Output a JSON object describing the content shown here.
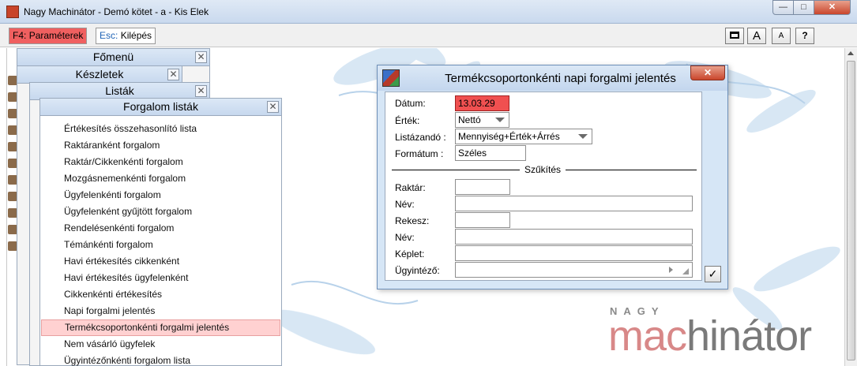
{
  "window": {
    "title": "Nagy Machinátor - Demó kötet - a - Kis Elek",
    "min": "—",
    "max": "□",
    "close": "✕"
  },
  "toolbar": {
    "f4_key": "F4:",
    "f4_label": "Paraméterek",
    "esc_key": "Esc:",
    "esc_label": "Kilépés",
    "font_big": "A",
    "font_small": "A",
    "help": "?"
  },
  "panels": {
    "fomenu": "Főmenü",
    "keszletek": "Készletek",
    "listak": "Listák",
    "forgalom": "Forgalom listák",
    "close": "✕"
  },
  "menu": {
    "items": [
      "Értékesítés összehasonlító lista",
      "Raktáranként forgalom",
      "Raktár/Cikkenkénti forgalom",
      "Mozgásnemenkénti forgalom",
      "Ügyfelenkénti forgalom",
      "Ügyfelenként gyűjtött forgalom",
      "Rendelésenkénti forgalom",
      "Témánkénti forgalom",
      "Havi értékesítés cikkenként",
      "Havi értékesítés ügyfelenként",
      "Cikkenkénti értékesítés",
      "Napi forgalmi jelentés",
      "Termékcsoportonkénti forgalmi jelentés",
      "Nem vásárló ügyfelek",
      "Ügyintézőnkénti forgalom lista"
    ],
    "selected_index": 12
  },
  "dialog": {
    "title": "Termékcsoportonkénti napi forgalmi jelentés",
    "close": "✕",
    "datum_label": "Dátum:",
    "datum_value": "13.03.29",
    "ertek_label": "Érték:",
    "ertek_value": "Nettó",
    "listazando_label": "Listázandó :",
    "listazando_value": "Mennyiség+Érték+Árrés",
    "formatum_label": "Formátum :",
    "formatum_value": "Széles",
    "szukites": "Szűkítés",
    "raktar_label": "Raktár:",
    "raktar_value": "",
    "nev1_label": "Név:",
    "nev1_value": "",
    "rekesz_label": "Rekesz:",
    "rekesz_value": "",
    "nev2_label": "Név:",
    "nev2_value": "",
    "keplet_label": "Képlet:",
    "keplet_value": "",
    "ugyintezo_label": "Ügyintéző:",
    "ugyintezo_value": "",
    "ok": "✓"
  },
  "logo": {
    "small": "NAGY",
    "mac": "mac",
    "rest": "hinátor"
  },
  "colors": {
    "accent_red": "#f05050",
    "selected_row": "#ffd1d1",
    "panel_header": "#c7d8ee"
  }
}
